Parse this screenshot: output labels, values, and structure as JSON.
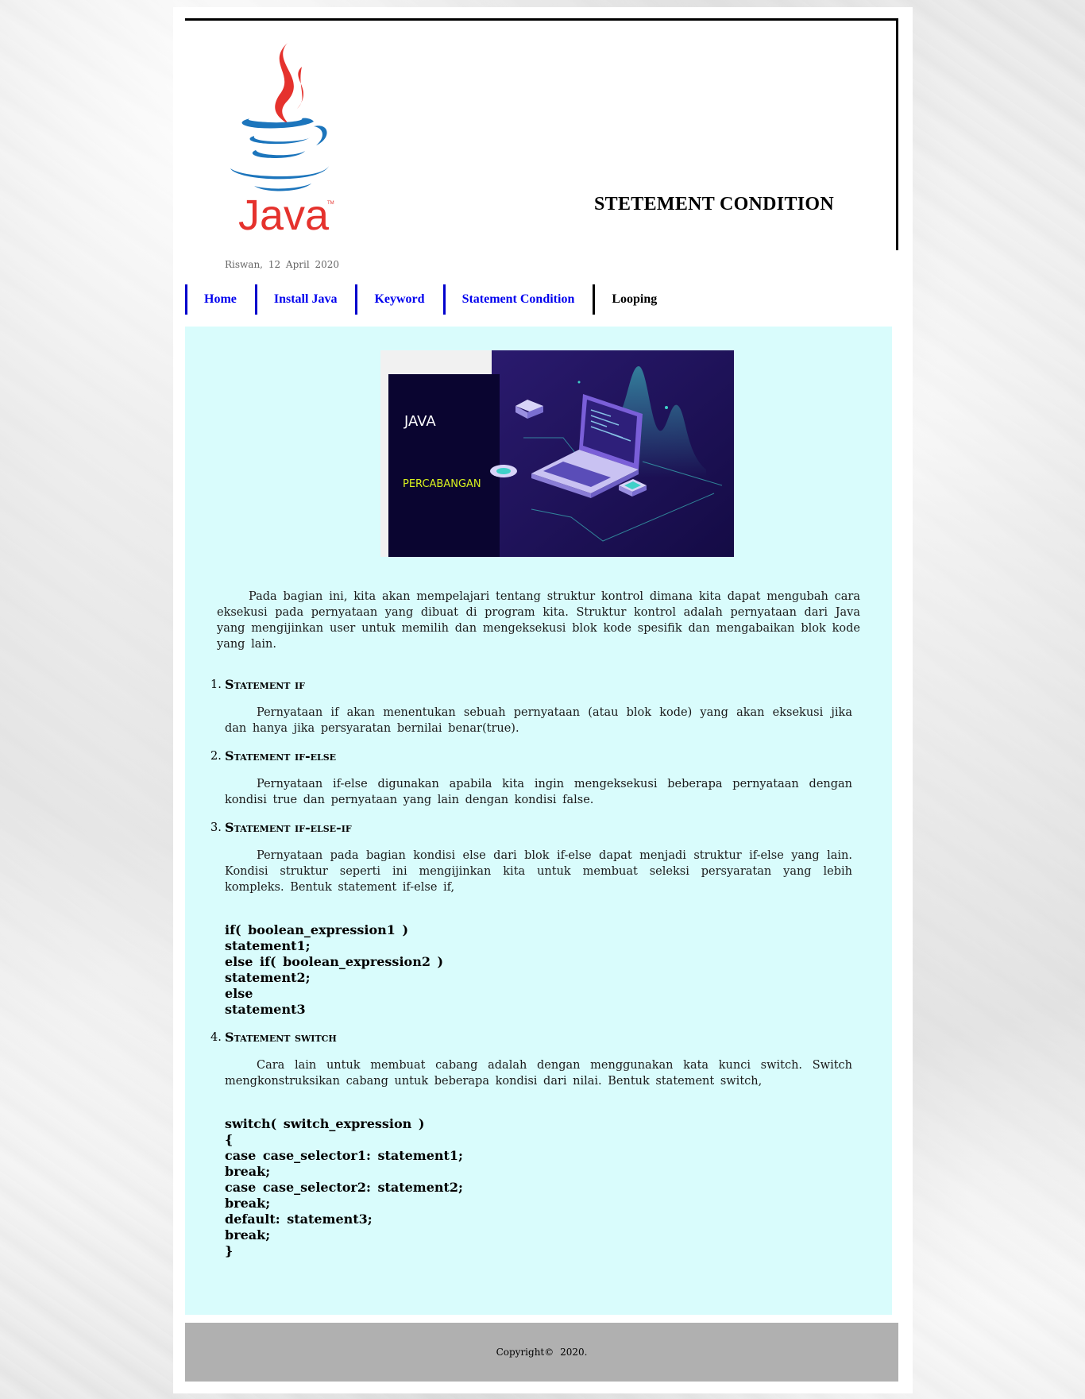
{
  "header": {
    "title": "STETEMENT CONDITION",
    "logo_text": "Java",
    "logo_tm": "TM"
  },
  "byline": "Riswan, 12 April 2020",
  "nav": {
    "items": [
      {
        "label": "Home"
      },
      {
        "label": "Install Java"
      },
      {
        "label": "Keyword"
      },
      {
        "label": "Statement Condition"
      },
      {
        "label": "Looping"
      }
    ],
    "active": "Looping"
  },
  "hero": {
    "title": "JAVA",
    "subtitle": "PERCABANGAN"
  },
  "content": {
    "intro": "Pada bagian ini, kita akan mempelajari tentang struktur kontrol dimana kita dapat mengubah cara eksekusi pada pernyataan yang dibuat di program kita. Struktur kontrol adalah pernyataan dari Java yang mengijinkan user untuk memilih dan mengeksekusi blok kode spesifik dan mengabaikan blok kode yang lain.",
    "sections": [
      {
        "number": "1.",
        "heading": "Statement if",
        "desc": "Pernyataan if akan menentukan sebuah pernyataan (atau blok kode) yang akan eksekusi jika dan hanya jika persyaratan bernilai benar(true)."
      },
      {
        "number": "2.",
        "heading": "Statement if-else",
        "desc": "Pernyataan if-else digunakan apabila kita ingin mengeksekusi beberapa pernyataan dengan kondisi true dan pernyataan yang lain dengan kondisi false."
      },
      {
        "number": "3.",
        "heading": "Statement if-else-if",
        "desc": "Pernyataan pada bagian kondisi else dari blok if-else dapat menjadi struktur if-else yang lain. Kondisi struktur seperti ini mengijinkan kita untuk membuat seleksi persyaratan yang lebih kompleks. Bentuk statement if-else if,",
        "code": "if( boolean_expression1 )\nstatement1;\nelse if( boolean_expression2 )\nstatement2;\nelse\nstatement3"
      },
      {
        "number": "4.",
        "heading": "Statement switch",
        "desc": "Cara lain untuk membuat cabang adalah dengan menggunakan kata kunci switch. Switch mengkonstruksikan cabang untuk beberapa kondisi dari nilai. Bentuk statement switch,",
        "code": "switch( switch_expression )\n{\ncase case_selector1: statement1;\nbreak;\ncase case_selector2: statement2;\nbreak;\ndefault: statement3;\nbreak;\n}"
      }
    ]
  },
  "footer": {
    "copyright": "Copyright© 2020."
  },
  "colors": {
    "nav_link": "#0000ee",
    "nav_border": "#0000cc",
    "content_bg": "#d9fcfc",
    "footer_bg": "#b0b0b0",
    "java_red": "#e5322d",
    "java_blue": "#1c75bc"
  }
}
